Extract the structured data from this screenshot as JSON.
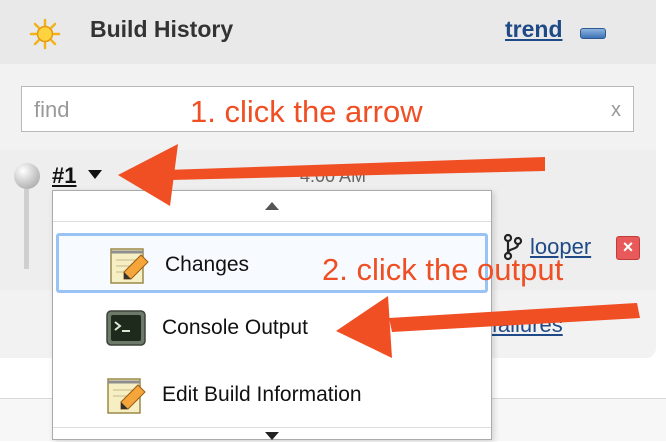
{
  "widget": {
    "title": "Build History",
    "trend_link": "trend",
    "icons": [
      "sun-icon",
      "collapse-icon"
    ]
  },
  "search": {
    "placeholder": "find",
    "value": "",
    "clear_label": "x"
  },
  "build": {
    "number": "#1",
    "time": "4:00 AM",
    "branch": "looper",
    "failures_link": "for failures",
    "delete_label": "×"
  },
  "dropdown_menu": {
    "items": [
      {
        "label": "Changes",
        "icon": "notepad-icon",
        "selected": true
      },
      {
        "label": "Console Output",
        "icon": "terminal-icon",
        "selected": false
      },
      {
        "label": "Edit Build Information",
        "icon": "notepad-icon",
        "selected": false
      }
    ]
  },
  "annotations": {
    "step1": "1. click the arrow",
    "step2": "2. click the output",
    "color": "#f04e23"
  }
}
